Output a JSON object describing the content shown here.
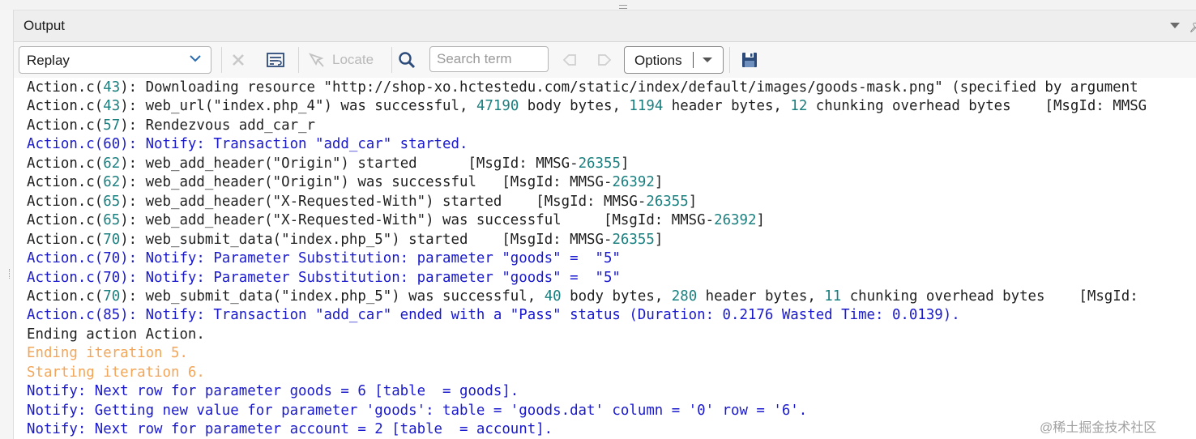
{
  "panel": {
    "title": "Output"
  },
  "toolbar": {
    "mode_selected": "Replay",
    "locate_label": "Locate",
    "search_placeholder": "Search term",
    "options_label": "Options",
    "icons": [
      "close-icon",
      "wrap-text-icon",
      "locate-icon",
      "magnifier-icon",
      "find-previous-icon",
      "find-next-icon",
      "save-icon"
    ]
  },
  "colors": {
    "default_text": "#1f1f1f",
    "notify_text": "#1a1acc",
    "iteration_text": "#f2a65a",
    "number_highlight": "#1a7f7f"
  },
  "log_lines": [
    {
      "type": "default",
      "text": "Action.c(43): Downloading resource \"http://shop-xo.hctestedu.com/static/index/default/images/goods-mask.png\" (specified by argument"
    },
    {
      "type": "default",
      "text": "Action.c(43): web_url(\"index.php_4\") was successful, 47190 body bytes, 1194 header bytes, 12 chunking overhead bytes    [MsgId: MMSG"
    },
    {
      "type": "default",
      "text": "Action.c(57): Rendezvous add_car_r"
    },
    {
      "type": "notify",
      "text": "Action.c(60): Notify: Transaction \"add_car\" started."
    },
    {
      "type": "default",
      "text": "Action.c(62): web_add_header(\"Origin\") started      [MsgId: MMSG-26355]"
    },
    {
      "type": "default",
      "text": "Action.c(62): web_add_header(\"Origin\") was successful   [MsgId: MMSG-26392]"
    },
    {
      "type": "default",
      "text": "Action.c(65): web_add_header(\"X-Requested-With\") started    [MsgId: MMSG-26355]"
    },
    {
      "type": "default",
      "text": "Action.c(65): web_add_header(\"X-Requested-With\") was successful     [MsgId: MMSG-26392]"
    },
    {
      "type": "default",
      "text": "Action.c(70): web_submit_data(\"index.php_5\") started    [MsgId: MMSG-26355]"
    },
    {
      "type": "notify",
      "text": "Action.c(70): Notify: Parameter Substitution: parameter \"goods\" =  \"5\""
    },
    {
      "type": "notify",
      "text": "Action.c(70): Notify: Parameter Substitution: parameter \"goods\" =  \"5\""
    },
    {
      "type": "default",
      "text": "Action.c(70): web_submit_data(\"index.php_5\") was successful, 40 body bytes, 280 header bytes, 11 chunking overhead bytes    [MsgId:"
    },
    {
      "type": "notify",
      "text": "Action.c(85): Notify: Transaction \"add_car\" ended with a \"Pass\" status (Duration: 0.2176 Wasted Time: 0.0139)."
    },
    {
      "type": "default",
      "text": "Ending action Action."
    },
    {
      "type": "iter",
      "text": "Ending iteration 5."
    },
    {
      "type": "iter",
      "text": "Starting iteration 6."
    },
    {
      "type": "notify",
      "text": "Notify: Next row for parameter goods = 6 [table  = goods]."
    },
    {
      "type": "notify",
      "text": "Notify: Getting new value for parameter 'goods': table = 'goods.dat' column = '0' row = '6'."
    },
    {
      "type": "notify",
      "text": "Notify: Next row for parameter account = 2 [table  = account]."
    }
  ],
  "watermark": "@稀土掘金技术社区"
}
